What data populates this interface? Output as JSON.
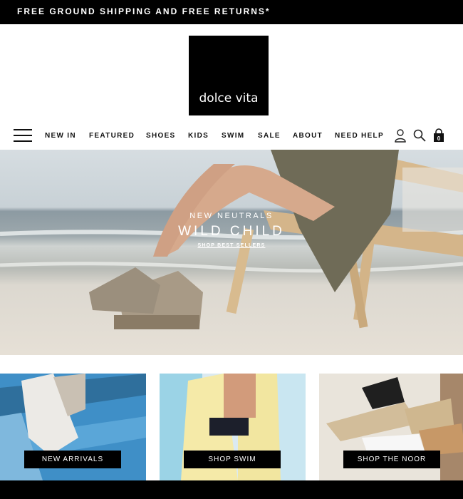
{
  "promo": {
    "text": "FREE GROUND SHIPPING AND FREE RETURNS*"
  },
  "brand": {
    "logo_text": "dolce vita"
  },
  "nav": {
    "items": [
      {
        "label": "NEW IN"
      },
      {
        "label": "FEATURED"
      },
      {
        "label": "SHOES"
      },
      {
        "label": "KIDS"
      },
      {
        "label": "SWIM"
      },
      {
        "label": "SALE"
      },
      {
        "label": "ABOUT"
      },
      {
        "label": "NEED HELP"
      }
    ],
    "icons": [
      "menu-icon",
      "account-icon",
      "search-icon",
      "cart-icon"
    ],
    "cart_count": "0"
  },
  "hero": {
    "subtitle": "NEW NEUTRALS",
    "title": "WILD CHILD",
    "cta": "SHOP BEST SELLERS"
  },
  "tiles": [
    {
      "label": "NEW ARRIVALS"
    },
    {
      "label": "SHOP SWIM"
    },
    {
      "label": "SHOP THE NOOR"
    }
  ]
}
